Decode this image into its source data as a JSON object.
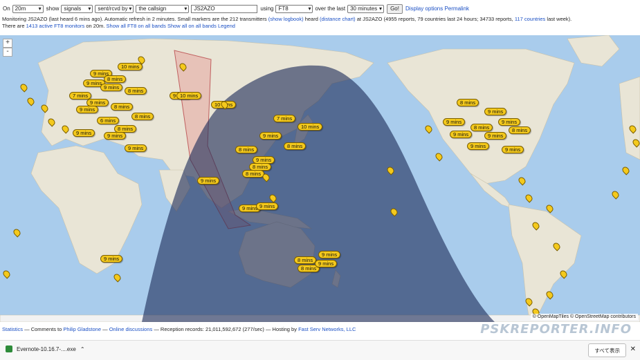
{
  "controls": {
    "on_label": "On",
    "band": "20m",
    "show_label": "show",
    "show": "signals",
    "direction": "sent/rcvd by",
    "target": "the callsign",
    "callsign": "JS2AZO",
    "using_label": "using",
    "mode": "FT8",
    "over_label": "over the last",
    "period": "30 minutes",
    "go": "Go!",
    "display_options": "Display options",
    "permalink": "Permalink"
  },
  "info": {
    "line2_a": "Monitoring JS2AZO (last heard 6 mins ago). Automatic refresh in 2 minutes. Small markers are the 212 transmitters",
    "show_logbook": "(show logbook)",
    "line2_b": "heard",
    "distance_chart": "(distance chart)",
    "line2_c": "at JS2AZO (4955 reports, 79 countries last 24 hours; 34733 reports,",
    "countries_link": "117 countries",
    "line2_d": "last week).",
    "line3_a": "There are",
    "monitors_link": "1413 active FT8 monitors",
    "line3_b": "on 20m.",
    "show_all_ft8": "Show all FT8 on all bands",
    "show_all": "Show all on all bands",
    "legend": "Legend"
  },
  "map": {
    "zoom_in": "+",
    "zoom_out": "-",
    "attribution": "© OpenMapTiles © OpenStreetMap contributors",
    "labels": [
      "10 mins",
      "9 mins",
      "8 mins",
      "9 mins",
      "9 mins",
      "7 mins",
      "8 mins",
      "9 mins",
      "8 mins",
      "9 mins",
      "6 mins",
      "8 mins",
      "9 mins",
      "9 mins",
      "9 mins",
      "10 mins",
      "7 mins",
      "10 mins",
      "9 mins",
      "8 mins",
      "8 mins",
      "9 mins",
      "8 mins",
      "8 mins",
      "9 mins",
      "9 mins",
      "9 mins",
      "8 mins",
      "9 mins",
      "8 mins",
      "9 mins",
      "9 mins",
      "8 mins",
      "9 mins",
      "9 mins",
      "8 mins",
      "9 mins",
      "9 mins",
      "9 mins",
      "8 mins",
      "9 mins",
      "9 mins",
      "10 mins",
      "9 mins",
      "8 mins"
    ]
  },
  "footer": {
    "statistics": "Statistics",
    "comments": "— Comments to",
    "author": "Philip Gladstone",
    "dash1": "—",
    "online": "Online discussions",
    "records": "— Reception records: 21,011,592,672 (277/sec) — Hosting by",
    "host": "Fast Serv Networks, LLC",
    "brand": "PSKREPORTER.INFO"
  },
  "download": {
    "file": "Evernote-10.16.7-....exe",
    "show_all": "すべて表示",
    "close": "✕"
  }
}
